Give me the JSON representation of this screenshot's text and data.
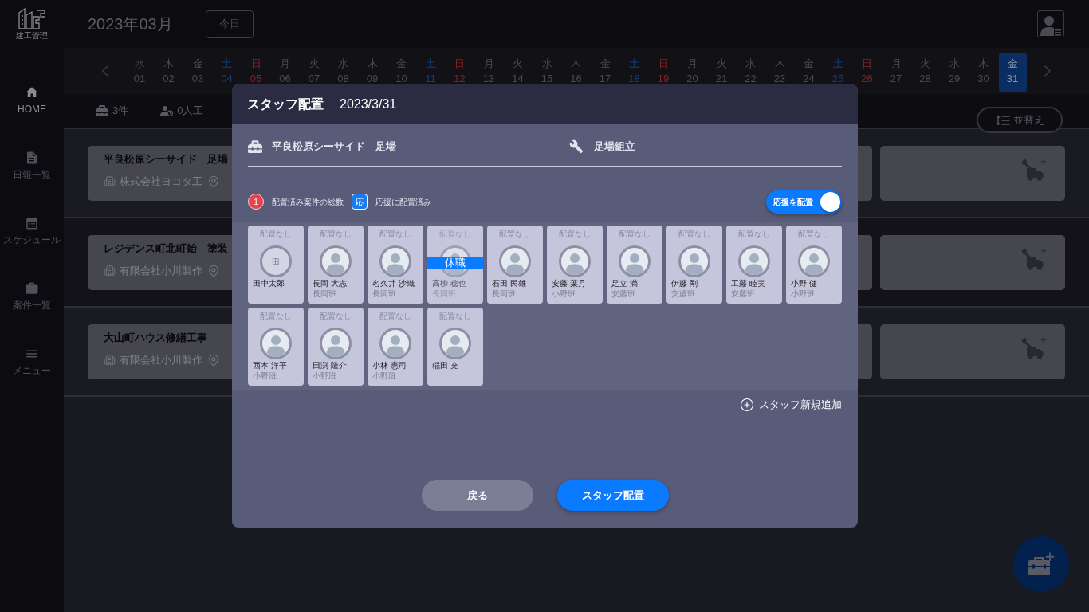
{
  "sidebar": {
    "logo_text": "建工管理",
    "items": [
      {
        "label": "HOME",
        "selected": true
      },
      {
        "label": "日報一覧",
        "selected": false
      },
      {
        "label": "スケジュール",
        "selected": false
      },
      {
        "label": "案件一覧",
        "selected": false
      },
      {
        "label": "メニュー",
        "selected": false
      }
    ]
  },
  "header": {
    "month": "2023年03月",
    "today_button": "今日"
  },
  "calendar": {
    "days": [
      {
        "weekday": "水",
        "day": "01",
        "kind": "weekday",
        "selected": false
      },
      {
        "weekday": "木",
        "day": "02",
        "kind": "weekday",
        "selected": false
      },
      {
        "weekday": "金",
        "day": "03",
        "kind": "weekday",
        "selected": false
      },
      {
        "weekday": "土",
        "day": "04",
        "kind": "saturday",
        "selected": false
      },
      {
        "weekday": "日",
        "day": "05",
        "kind": "sunday",
        "selected": false
      },
      {
        "weekday": "月",
        "day": "06",
        "kind": "weekday",
        "selected": false
      },
      {
        "weekday": "火",
        "day": "07",
        "kind": "weekday",
        "selected": false
      },
      {
        "weekday": "水",
        "day": "08",
        "kind": "weekday",
        "selected": false
      },
      {
        "weekday": "木",
        "day": "09",
        "kind": "weekday",
        "selected": false
      },
      {
        "weekday": "金",
        "day": "10",
        "kind": "weekday",
        "selected": false
      },
      {
        "weekday": "土",
        "day": "11",
        "kind": "saturday",
        "selected": false
      },
      {
        "weekday": "日",
        "day": "12",
        "kind": "sunday",
        "selected": false
      },
      {
        "weekday": "月",
        "day": "13",
        "kind": "weekday",
        "selected": false
      },
      {
        "weekday": "火",
        "day": "14",
        "kind": "weekday",
        "selected": false
      },
      {
        "weekday": "水",
        "day": "15",
        "kind": "weekday",
        "selected": false
      },
      {
        "weekday": "木",
        "day": "16",
        "kind": "weekday",
        "selected": false
      },
      {
        "weekday": "金",
        "day": "17",
        "kind": "weekday",
        "selected": false
      },
      {
        "weekday": "土",
        "day": "18",
        "kind": "saturday",
        "selected": false
      },
      {
        "weekday": "日",
        "day": "19",
        "kind": "sunday",
        "selected": false
      },
      {
        "weekday": "月",
        "day": "20",
        "kind": "weekday",
        "selected": false
      },
      {
        "weekday": "火",
        "day": "21",
        "kind": "weekday",
        "selected": false
      },
      {
        "weekday": "水",
        "day": "22",
        "kind": "weekday",
        "selected": false
      },
      {
        "weekday": "木",
        "day": "23",
        "kind": "weekday",
        "selected": false
      },
      {
        "weekday": "金",
        "day": "24",
        "kind": "weekday",
        "selected": false
      },
      {
        "weekday": "土",
        "day": "25",
        "kind": "saturday",
        "selected": false
      },
      {
        "weekday": "日",
        "day": "26",
        "kind": "sunday",
        "selected": false
      },
      {
        "weekday": "月",
        "day": "27",
        "kind": "weekday",
        "selected": false
      },
      {
        "weekday": "火",
        "day": "28",
        "kind": "weekday",
        "selected": false
      },
      {
        "weekday": "水",
        "day": "29",
        "kind": "weekday",
        "selected": false
      },
      {
        "weekday": "木",
        "day": "30",
        "kind": "weekday",
        "selected": false
      },
      {
        "weekday": "金",
        "day": "31",
        "kind": "weekday",
        "selected": true
      }
    ]
  },
  "summary": {
    "projects": "3件",
    "workers": "0人工",
    "sort_button": "並替え"
  },
  "projects": [
    {
      "title": "平良松原シーサイド　足場",
      "company": "株式会社ヨコタ工"
    },
    {
      "title": "レジデンス町北町始　塗装",
      "company": "有限会社小川製作"
    },
    {
      "title": "大山町ハウス修繕工事",
      "company": "有限会社小川製作"
    }
  ],
  "dialog": {
    "title": "スタッフ配置",
    "date": "2023/3/31",
    "project": "平良松原シーサイド　足場",
    "work": "足場組立",
    "legend": [
      {
        "kind": "count",
        "badge": "1",
        "label": "配置済み案件の総数"
      },
      {
        "kind": "support",
        "badge": "応",
        "label": "応援に配置済み"
      }
    ],
    "support_toggle": {
      "label": "応援を配置",
      "on": true
    },
    "staff": [
      {
        "assignment": "配置なし",
        "avatar": {
          "kind": "initial",
          "text": "田"
        },
        "name": "田中太郎",
        "on_leave": false
      },
      {
        "assignment": "配置なし",
        "avatar": {
          "kind": "photo"
        },
        "name": "長岡 大志",
        "team": "長岡班",
        "on_leave": false
      },
      {
        "assignment": "配置なし",
        "avatar": {
          "kind": "photo"
        },
        "name": "名久井 沙織",
        "team": "長岡班",
        "on_leave": false
      },
      {
        "assignment": "配置なし",
        "avatar": {
          "kind": "photo"
        },
        "name": "高柳 稔也",
        "team": "長岡班",
        "on_leave": true,
        "leave_label": "休職"
      },
      {
        "assignment": "配置なし",
        "avatar": {
          "kind": "photo"
        },
        "name": "石田 民雄",
        "team": "長岡班",
        "on_leave": false
      },
      {
        "assignment": "配置なし",
        "avatar": {
          "kind": "photo"
        },
        "name": "安藤 葉月",
        "team": "小野班",
        "on_leave": false
      },
      {
        "assignment": "配置なし",
        "avatar": {
          "kind": "photo"
        },
        "name": "足立 満",
        "team": "安藤班",
        "on_leave": false
      },
      {
        "assignment": "配置なし",
        "avatar": {
          "kind": "photo"
        },
        "name": "伊藤 剛",
        "team": "安藤班",
        "on_leave": false
      },
      {
        "assignment": "配置なし",
        "avatar": {
          "kind": "photo"
        },
        "name": "工藤 睦実",
        "team": "安藤班",
        "on_leave": false
      },
      {
        "assignment": "配置なし",
        "avatar": {
          "kind": "photo"
        },
        "name": "小野 健",
        "team": "小野班",
        "on_leave": false
      },
      {
        "assignment": "配置なし",
        "avatar": {
          "kind": "photo"
        },
        "name": "西本 洋平",
        "team": "小野班",
        "on_leave": false
      },
      {
        "assignment": "配置なし",
        "avatar": {
          "kind": "photo"
        },
        "name": "田渕 隆介",
        "team": "小野班",
        "on_leave": false
      },
      {
        "assignment": "配置なし",
        "avatar": {
          "kind": "photo"
        },
        "name": "小林 憲司",
        "team": "小野班",
        "on_leave": false
      },
      {
        "assignment": "配置なし",
        "avatar": {
          "kind": "photo"
        },
        "name": "稲田 充",
        "on_leave": false
      }
    ],
    "add_staff": "スタッフ新規追加",
    "buttons": [
      {
        "kind": "secondary",
        "label": "戻る"
      },
      {
        "kind": "primary",
        "label": "スタッフ配置"
      }
    ]
  }
}
